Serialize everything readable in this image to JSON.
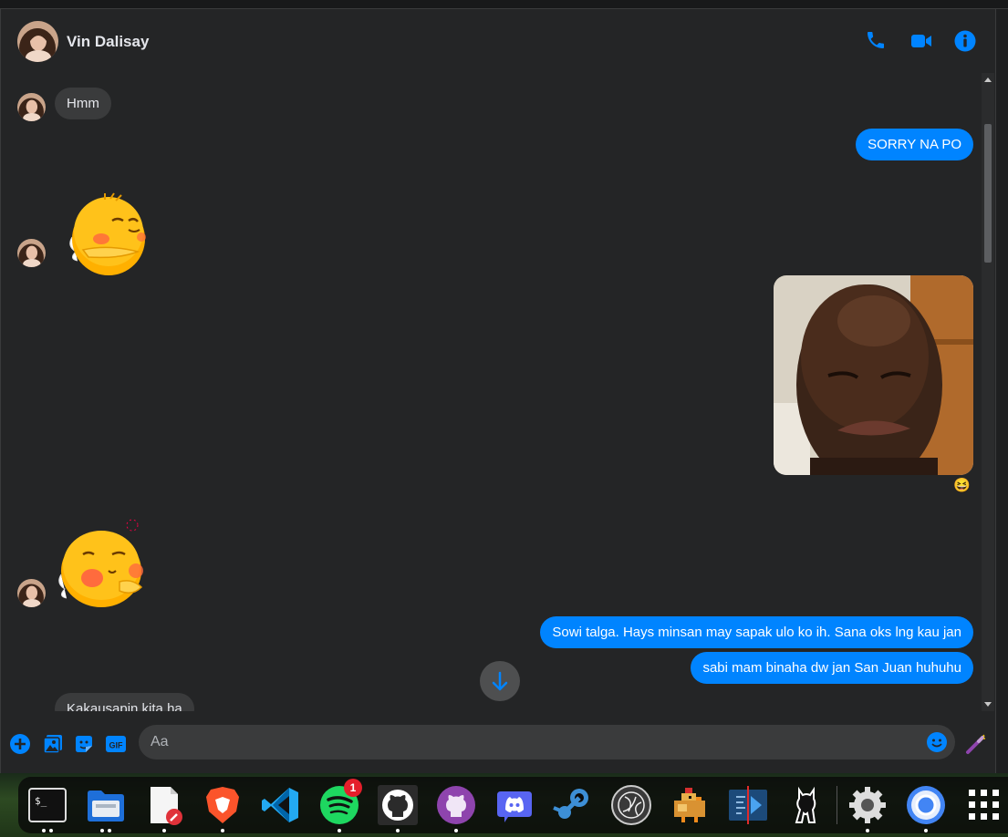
{
  "header": {
    "contact_name": "Vin Dalisay",
    "icons": [
      "phone-icon",
      "video-call-icon",
      "info-icon"
    ]
  },
  "messages": [
    {
      "from": "them",
      "type": "text",
      "text": "Hmm"
    },
    {
      "from": "me",
      "type": "text",
      "text": "SORRY NA PO"
    },
    {
      "from": "them",
      "type": "sticker",
      "sticker": "yellow-chick-arms-crossed-sticker"
    },
    {
      "from": "me",
      "type": "image",
      "image": "crying-man-photo",
      "reaction": "😆"
    },
    {
      "from": "them",
      "type": "sticker",
      "sticker": "yellow-chick-pouting-sticker"
    },
    {
      "from": "me",
      "type": "text",
      "text": "Sowi talga. Hays minsan may sapak ulo ko ih. Sana oks lng kau jan"
    },
    {
      "from": "me",
      "type": "text",
      "text": "sabi mam binaha dw jan San Juan huhuhu"
    },
    {
      "from": "them",
      "type": "text",
      "text": "Kakausapin kita ha"
    }
  ],
  "composer": {
    "placeholder": "Aa",
    "value": "",
    "icons": [
      "add-icon",
      "photo-icon",
      "sticker-icon",
      "gif-icon",
      "emoji-icon",
      "magic-wand-icon"
    ],
    "gif_label": "GIF"
  },
  "dock": {
    "apps": [
      "terminal",
      "files",
      "text-editor",
      "brave",
      "vscode",
      "spotify",
      "github",
      "github-desktop",
      "discord",
      "steam",
      "obs",
      "chicken-game",
      "kdenlive",
      "gimp",
      "settings",
      "chrome",
      "app-grid"
    ],
    "spotify_badge": "1"
  },
  "colors": {
    "accent": "#0084ff",
    "bubble_in": "#3a3b3c",
    "background": "#242526"
  }
}
